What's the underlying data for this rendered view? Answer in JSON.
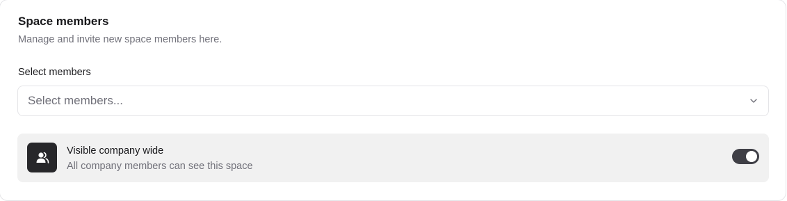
{
  "section": {
    "title": "Space members",
    "subtitle": "Manage and invite new space members here."
  },
  "members_select": {
    "label": "Select members",
    "placeholder": "Select members...",
    "icon": "chevron-down-icon"
  },
  "visibility": {
    "icon": "users-icon",
    "title": "Visible company wide",
    "description": "All company members can see this space",
    "enabled": true
  },
  "colors": {
    "toggle_on": "#3f3f46",
    "icon_tile": "#27272a",
    "row_background": "#f1f1f1"
  }
}
